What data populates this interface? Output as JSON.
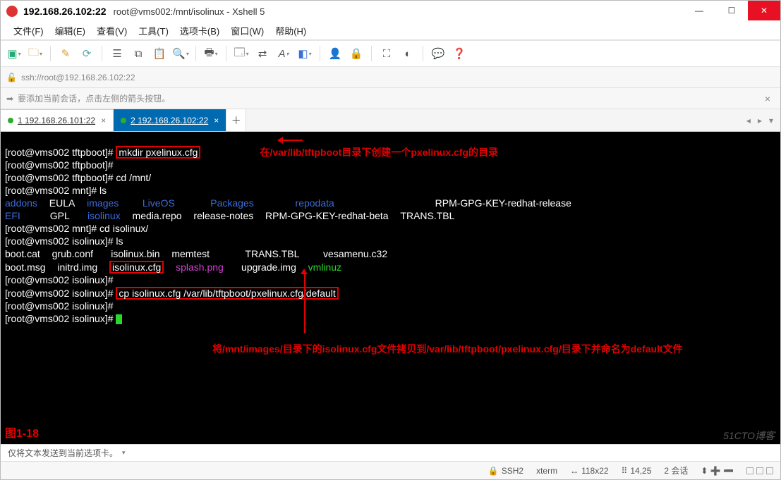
{
  "title_ip": "192.168.26.102:22",
  "subtitle": "root@vms002:/mnt/isolinux - Xshell 5",
  "menu": {
    "file": "文件(F)",
    "edit": "编辑(E)",
    "view": "查看(V)",
    "tools": "工具(T)",
    "tabs": "选项卡(B)",
    "window": "窗口(W)",
    "help": "帮助(H)"
  },
  "address": "ssh://root@192.168.26.102:22",
  "banner_msg": "要添加当前会话，点击左侧的箭头按钮。",
  "tab1_label": "1 192.168.26.101:22",
  "tab2_label": "2 192.168.26.102:22",
  "cmd_mkdir": "mkdir pxelinux.cfg",
  "anno1": "在/var/lib/tftpboot目录下创建一个pxelinux.cfg的目录",
  "anno2": "将/mnt/images/目录下的isolinux.cfg文件拷贝到/var/lib/tftpboot/pxelinux.cfg/目录下并命名为default文件",
  "cmd_cd_mnt": "cd /mnt/",
  "cmd_ls": "ls",
  "cmd_cd_iso": "cd isolinux/",
  "cmd_cp": "cp isolinux.cfg /var/lib/tftpboot/pxelinux.cfg/default",
  "ls1": {
    "addons": "addons",
    "eula": "EULA",
    "images": "images",
    "liveos": "LiveOS",
    "pkgs": "Packages",
    "repodata": "repodata",
    "rpm1": "RPM-GPG-KEY-redhat-release",
    "efi": "EFI",
    "gpl": "GPL",
    "isolinux": "isolinux",
    "mediarepo": "media.repo",
    "relnotes": "release-notes",
    "rpm2": "RPM-GPG-KEY-redhat-beta",
    "trans": "TRANS.TBL"
  },
  "ls2": {
    "bootcat": "boot.cat",
    "grub": "grub.conf",
    "isobin": "isolinux.bin",
    "memtest": "memtest",
    "trans": "TRANS.TBL",
    "vesa": "vesamenu.c32",
    "bootmsg": "boot.msg",
    "initrd": "initrd.img",
    "isocfg": "isolinux.cfg",
    "splash": "splash.png",
    "upgrade": "upgrade.img",
    "vmlinuz": "vmlinuz"
  },
  "prompt": {
    "tftp": "[root@vms002 tftpboot]# ",
    "mnt": "[root@vms002 mnt]# ",
    "iso": "[root@vms002 isolinux]# "
  },
  "figlabel": "图1-18",
  "status_send": "仅将文本发送到当前选项卡。",
  "status": {
    "proto": "SSH2",
    "term": "xterm",
    "size": "118x22",
    "cursor": "14,25",
    "sessions": "2 会话"
  },
  "watermark": "51CTO博客"
}
